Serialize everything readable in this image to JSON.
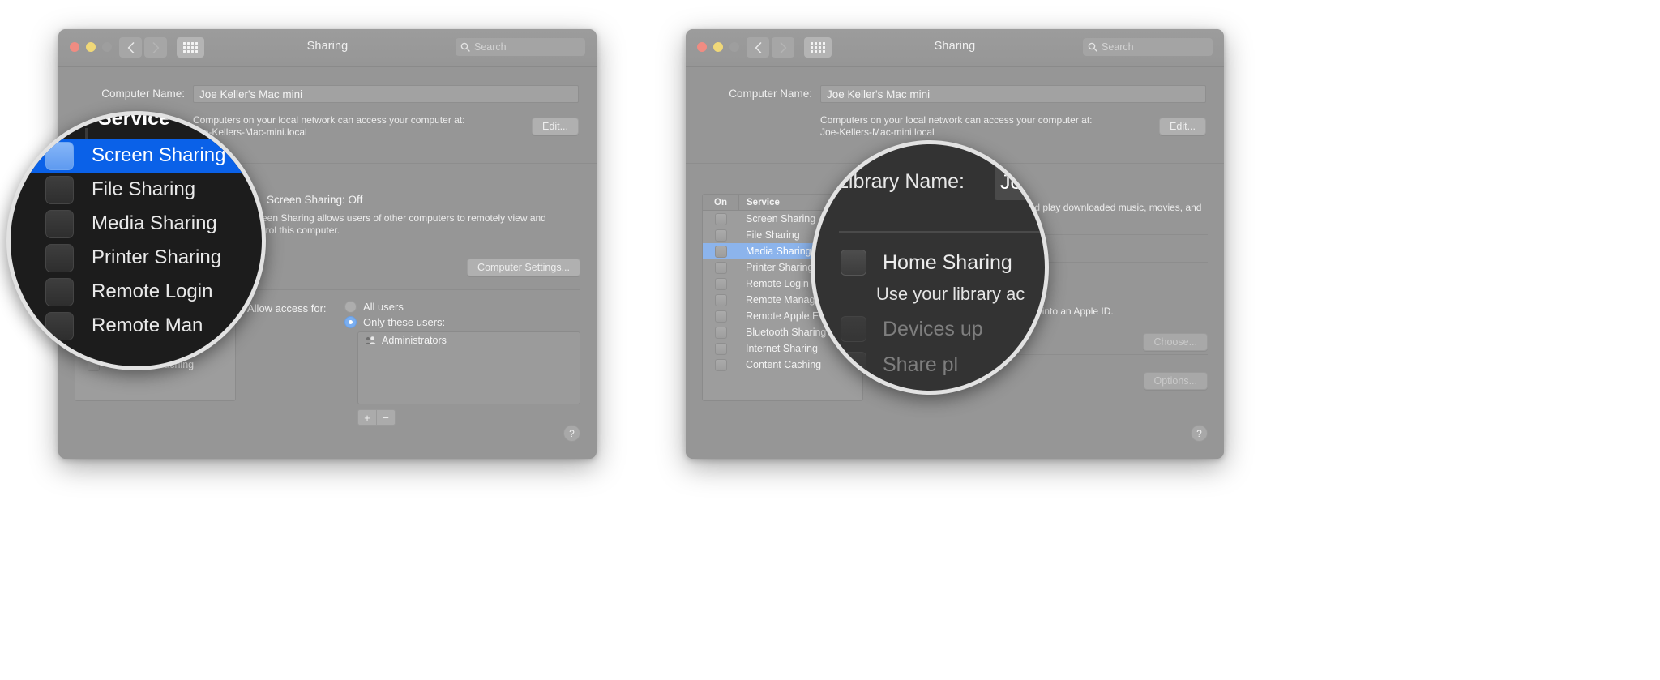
{
  "window_title": "Sharing",
  "search": {
    "placeholder": "Search",
    "icon": "search-icon"
  },
  "traffic_lights": {
    "close": "close-button",
    "minimize": "minimize-button",
    "maximize": "maximize-button"
  },
  "nav": {
    "back": "back-chevron-icon",
    "forward": "forward-chevron-icon",
    "grid": "show-all-grid-icon"
  },
  "computer_name": {
    "label": "Computer Name:",
    "value": "Joe Keller's Mac mini",
    "hint_line1": "Computers on your local network can access your computer at:",
    "hint_line2": "Joe-Kellers-Mac-mini.local",
    "edit_button": "Edit..."
  },
  "service_table": {
    "col_on": "On",
    "col_service": "Service",
    "rows": [
      {
        "name": "Screen Sharing",
        "on": false,
        "selected": false
      },
      {
        "name": "File Sharing",
        "on": false,
        "selected": false
      },
      {
        "name": "Media Sharing",
        "on": false,
        "selected": true
      },
      {
        "name": "Printer Sharing",
        "on": false,
        "selected": false
      },
      {
        "name": "Remote Login",
        "on": false,
        "selected": false
      },
      {
        "name": "Remote Management",
        "on": false,
        "selected": false
      },
      {
        "name": "Remote Apple Events",
        "on": false,
        "selected": false
      },
      {
        "name": "Bluetooth Sharing",
        "on": false,
        "selected": false
      },
      {
        "name": "Internet Sharing",
        "on": false,
        "selected": false
      },
      {
        "name": "Content Caching",
        "on": false,
        "selected": false
      }
    ]
  },
  "left_detail": {
    "status": "Screen Sharing: Off",
    "description": "Screen Sharing allows users of other computers to remotely view and control this computer.",
    "computer_settings_button": "Computer Settings...",
    "access_label": "Allow access for:",
    "option_all_users": "All users",
    "option_only_these_users": "Only these users:",
    "selected_option": "only_these_users",
    "user_rows": [
      {
        "name": "Administrators",
        "icon": "users-group-icon"
      }
    ],
    "add_button": "+",
    "remove_button": "−"
  },
  "right_detail": {
    "desc_fragment": "se and play downloaded music, movies, and",
    "library_fragment": "ry",
    "apple_id_fragment": "signed into an Apple ID.",
    "choose_button": "Choose...",
    "options_button": "Options..."
  },
  "left_magnifier": {
    "header": "Service",
    "items": [
      {
        "label": "Screen Sharing",
        "selected": true
      },
      {
        "label": "File Sharing",
        "selected": false
      },
      {
        "label": "Media Sharing",
        "selected": false
      },
      {
        "label": "Printer Sharing",
        "selected": false
      },
      {
        "label": "Remote Login",
        "selected": false
      },
      {
        "label": "Remote Man",
        "selected": false
      }
    ],
    "highlight_color": "#0a61e8"
  },
  "right_magnifier": {
    "library_label": "Library Name:",
    "library_value": "Jo",
    "home_sharing": "Home Sharing",
    "home_sharing_checked": false,
    "use_library": "Use your library ac",
    "devices_row": "Devices up",
    "share_row": "Share pl"
  },
  "help_button": "?"
}
